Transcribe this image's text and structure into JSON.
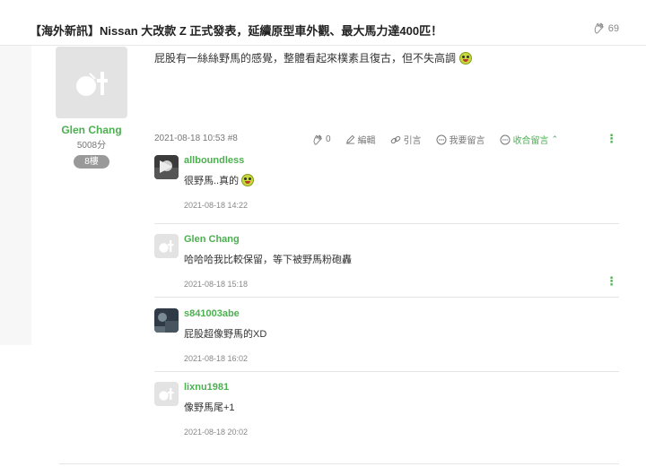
{
  "thread": {
    "title": "【海外新訊】Nissan 大改款 Z 正式發表，延續原型車外觀、最大馬力達400匹！",
    "like_count": "69"
  },
  "post": {
    "author": "Glen Chang",
    "score": "5008分",
    "floor": "8樓",
    "text": "屁股有一絲絲野馬的感覺，整體看起來樸素且復古，但不失高調",
    "date_floor": "2021-08-18 10:53 #8",
    "actions": {
      "like_count": "0",
      "edit": "編輯",
      "quote": "引言",
      "reply": "我要留言",
      "collapse": "收合留言"
    }
  },
  "replies": [
    {
      "name": "allboundless",
      "text": "很野馬..真的",
      "time": "2021-08-18 14:22",
      "avatar": "photo"
    },
    {
      "name": "Glen Chang",
      "text": "哈哈哈我比較保留，等下被野馬粉砲轟",
      "time": "2021-08-18 15:18",
      "avatar": "default"
    },
    {
      "name": "s841003abe",
      "text": "屁股超像野馬的XD",
      "time": "2021-08-18 16:02",
      "avatar": "photo"
    },
    {
      "name": "lixnu1981",
      "text": "像野馬尾+1",
      "time": "2021-08-18 20:02",
      "avatar": "default"
    }
  ],
  "colors": {
    "accent": "#4caf50",
    "badge": "#999999",
    "emoji": "#c7d93b"
  }
}
